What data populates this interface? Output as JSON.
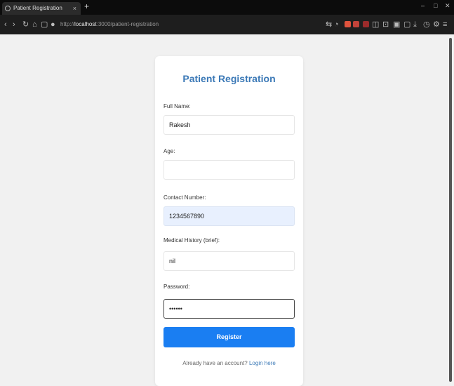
{
  "browser": {
    "tab_title": "Patient Registration",
    "tab_close": "×",
    "new_tab": "+",
    "address_scheme": "http://",
    "address_host": "localhost",
    "address_path": ":3000/patient-registration"
  },
  "form": {
    "title": "Patient Registration",
    "full_name_label": "Full Name:",
    "full_name_value": "Rakesh",
    "age_label": "Age:",
    "age_value": "",
    "contact_label": "Contact Number:",
    "contact_value": "1234567890",
    "history_label": "Medical History (brief):",
    "history_value": "nil",
    "password_label": "Password:",
    "password_value": "••••••",
    "submit_label": "Register",
    "login_prompt": "Already have an account?",
    "login_link": "Login here"
  },
  "colors": {
    "title": "#3a78b6",
    "button": "#1a7ef2",
    "autofill": "#e8f0fe"
  }
}
